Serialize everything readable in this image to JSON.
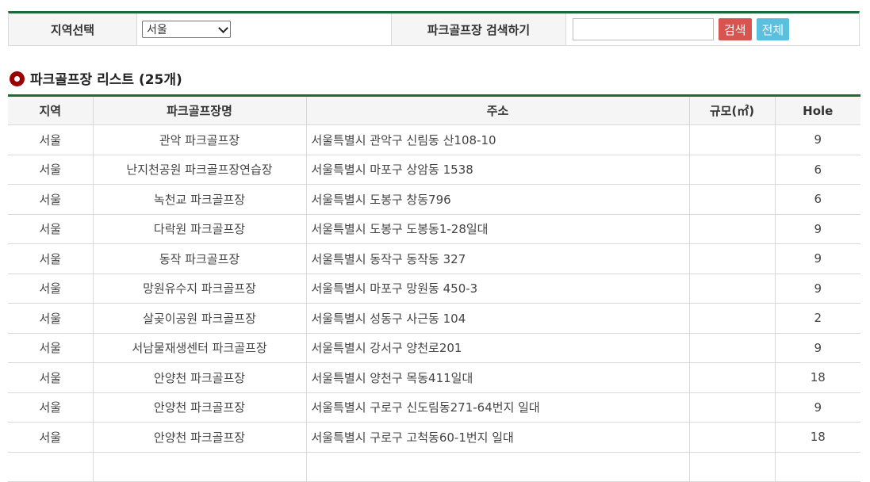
{
  "search": {
    "region_label": "지역선택",
    "region_selected": "서울",
    "search_label": "파크골프장 검색하기",
    "search_value": "",
    "search_button": "검색",
    "all_button": "전체"
  },
  "list": {
    "title": "파크골프장 리스트 (25개)"
  },
  "table": {
    "headers": [
      "지역",
      "파크골프장명",
      "주소",
      "규모(㎡)",
      "Hole"
    ],
    "rows": [
      {
        "region": "서울",
        "name": "관악 파크골프장",
        "address": "서울특별시 관악구 신림동 산108-10",
        "size": "",
        "hole": "9"
      },
      {
        "region": "서울",
        "name": "난지천공원 파크골프장연습장",
        "address": "서울특별시 마포구 상암동 1538",
        "size": "",
        "hole": "6"
      },
      {
        "region": "서울",
        "name": "녹천교 파크골프장",
        "address": "서울특별시 도봉구 창동796",
        "size": "",
        "hole": "6"
      },
      {
        "region": "서울",
        "name": "다락원 파크골프장",
        "address": "서울특별시 도봉구 도봉동1-28일대",
        "size": "",
        "hole": "9"
      },
      {
        "region": "서울",
        "name": "동작 파크골프장",
        "address": "서울특별시 동작구 동작동 327",
        "size": "",
        "hole": "9"
      },
      {
        "region": "서울",
        "name": "망원유수지 파크골프장",
        "address": "서울특별시 마포구 망원동 450-3",
        "size": "",
        "hole": "9"
      },
      {
        "region": "서울",
        "name": "살곶이공원 파크골프장",
        "address": "서울특별시 성동구 사근동 104",
        "size": "",
        "hole": "2"
      },
      {
        "region": "서울",
        "name": "서남물재생센터 파크골프장",
        "address": "서울특별시 강서구 양천로201",
        "size": "",
        "hole": "9"
      },
      {
        "region": "서울",
        "name": "안양천 파크골프장",
        "address": "서울특별시 양천구 목동411일대",
        "size": "",
        "hole": "18"
      },
      {
        "region": "서울",
        "name": "안양천 파크골프장",
        "address": "서울특별시 구로구 신도림동271-64번지 일대",
        "size": "",
        "hole": "9"
      },
      {
        "region": "서울",
        "name": "안양천 파크골프장",
        "address": "서울특별시 구로구 고척동60-1번지 일대",
        "size": "",
        "hole": "18"
      },
      {
        "region": "",
        "name": "",
        "address": "",
        "size": "",
        "hole": ""
      }
    ]
  }
}
